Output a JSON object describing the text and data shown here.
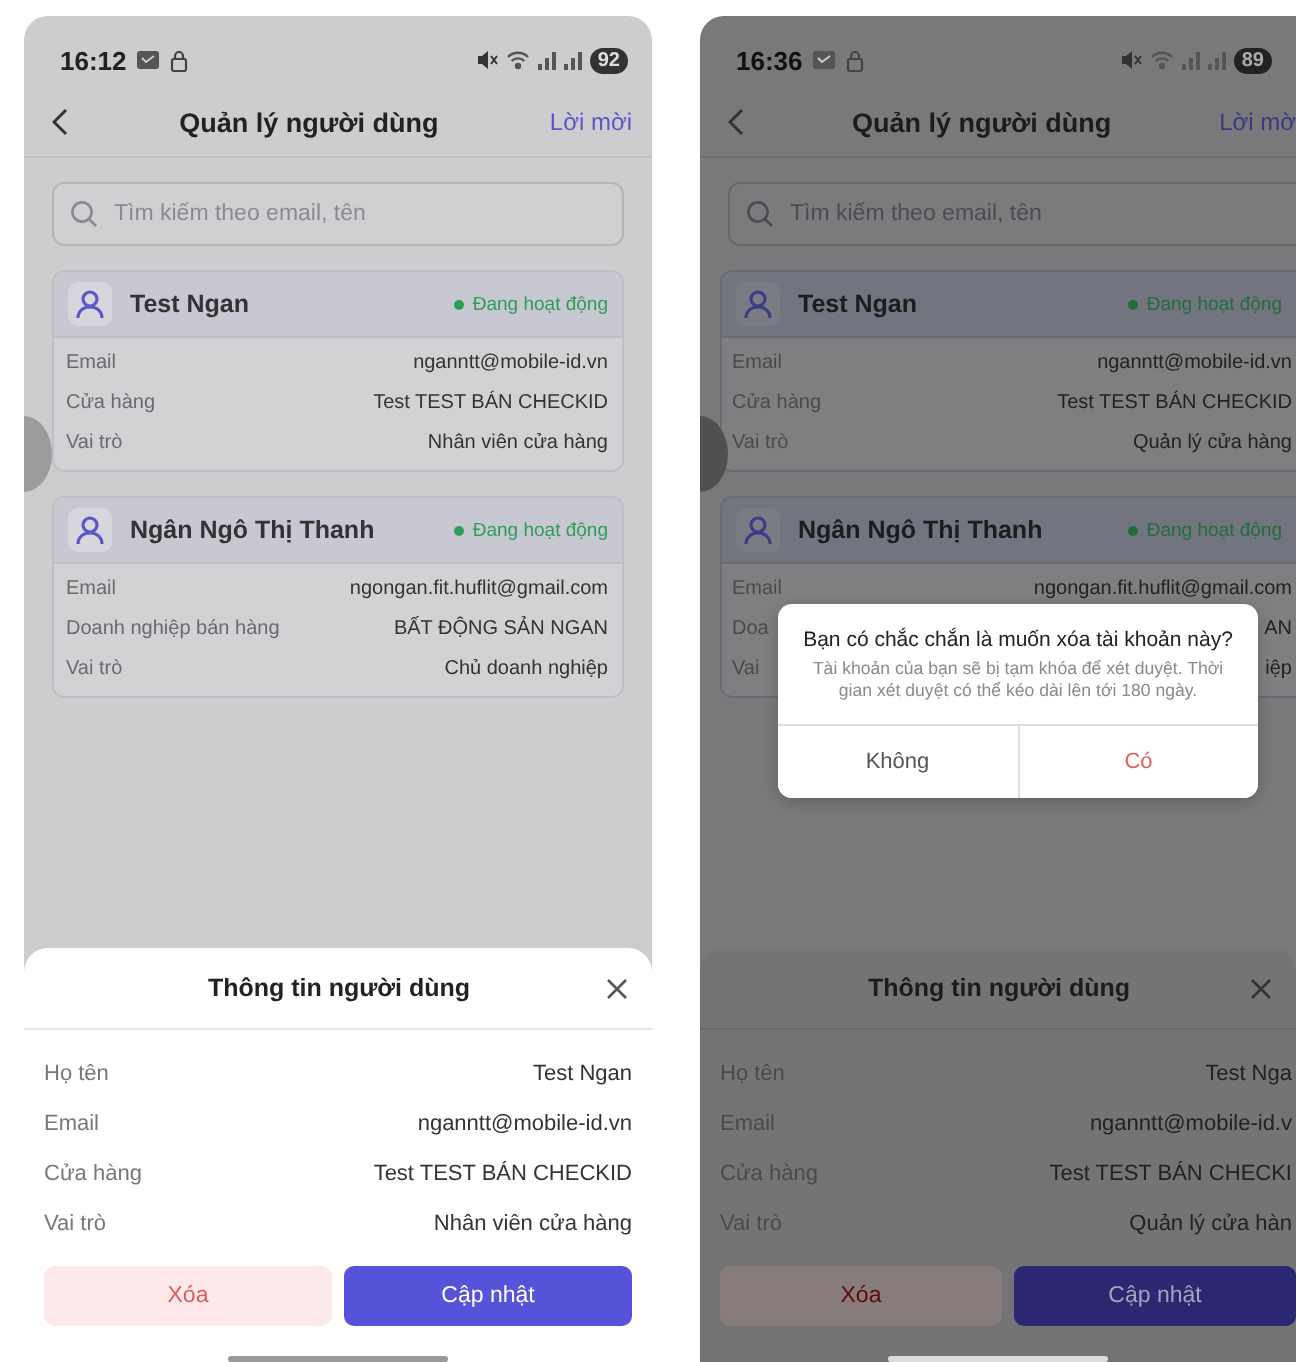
{
  "phones": [
    {
      "status_bar": {
        "time": "16:12",
        "battery": "92"
      },
      "header": {
        "title": "Quản lý người dùng",
        "action": "Lời mời"
      },
      "search": {
        "placeholder": "Tìm kiếm theo email, tên"
      },
      "users": [
        {
          "name": "Test Ngan",
          "status": "Đang hoạt động",
          "fields": [
            {
              "label": "Email",
              "value": "nganntt@mobile-id.vn"
            },
            {
              "label": "Cửa hàng",
              "value": "Test TEST BÁN CHECKID"
            },
            {
              "label": "Vai trò",
              "value": "Nhân viên cửa hàng"
            }
          ]
        },
        {
          "name": "Ngân Ngô Thị Thanh",
          "status": "Đang hoạt động",
          "fields": [
            {
              "label": "Email",
              "value": "ngongan.fit.huflit@gmail.com"
            },
            {
              "label": "Doanh nghiệp bán hàng",
              "value": "BẤT ĐỘNG SẢN NGAN"
            },
            {
              "label": "Vai trò",
              "value": "Chủ doanh nghiệp"
            }
          ]
        }
      ],
      "sheet": {
        "title": "Thông tin người dùng",
        "fields": [
          {
            "label": "Họ tên",
            "value": "Test Ngan"
          },
          {
            "label": "Email",
            "value": "nganntt@mobile-id.vn"
          },
          {
            "label": "Cửa hàng",
            "value": "Test TEST BÁN CHECKID"
          },
          {
            "label": "Vai trò",
            "value": "Nhân viên cửa hàng"
          }
        ],
        "buttons": [
          {
            "label": "Xóa",
            "kind": "danger"
          },
          {
            "label": "Cập nhật",
            "kind": "primary"
          }
        ]
      }
    },
    {
      "status_bar": {
        "time": "16:36",
        "battery": "89"
      },
      "header": {
        "title": "Quản lý người dùng",
        "action": "Lời mờ"
      },
      "search": {
        "placeholder": "Tìm kiếm theo email, tên"
      },
      "users": [
        {
          "name": "Test Ngan",
          "status": "Đang hoạt động",
          "fields": [
            {
              "label": "Email",
              "value": "nganntt@mobile-id.vn"
            },
            {
              "label": "Cửa hàng",
              "value": "Test TEST BÁN CHECKID"
            },
            {
              "label": "Vai trò",
              "value": "Quản lý cửa hàng"
            }
          ]
        },
        {
          "name": "Ngân Ngô Thị Thanh",
          "status": "Đang hoạt động",
          "fields": [
            {
              "label": "Email",
              "value": "ngongan.fit.huflit@gmail.com"
            },
            {
              "label": "Doa",
              "value": "AN"
            },
            {
              "label": "Vai",
              "value": "iệp"
            }
          ]
        }
      ],
      "sheet": {
        "title": "Thông tin người dùng",
        "fields": [
          {
            "label": "Họ tên",
            "value": "Test Nga"
          },
          {
            "label": "Email",
            "value": "nganntt@mobile-id.v"
          },
          {
            "label": "Cửa hàng",
            "value": "Test TEST BÁN CHECKI"
          },
          {
            "label": "Vai trò",
            "value": "Quản lý cửa hàn"
          }
        ],
        "buttons": [
          {
            "label": "Xóa",
            "kind": "danger"
          },
          {
            "label": "Cập nhật",
            "kind": "primary"
          }
        ]
      },
      "dialog": {
        "title": "Bạn có chắc chắn là muốn xóa tài khoản này?",
        "message": "Tài khoản của bạn sẽ bị tạm khóa để xét duyệt. Thời gian xét duyệt có thể kéo dài lên tới 180 ngày.",
        "buttons": [
          {
            "label": "Không",
            "kind": "cancel"
          },
          {
            "label": "Có",
            "kind": "confirm"
          }
        ]
      }
    }
  ]
}
